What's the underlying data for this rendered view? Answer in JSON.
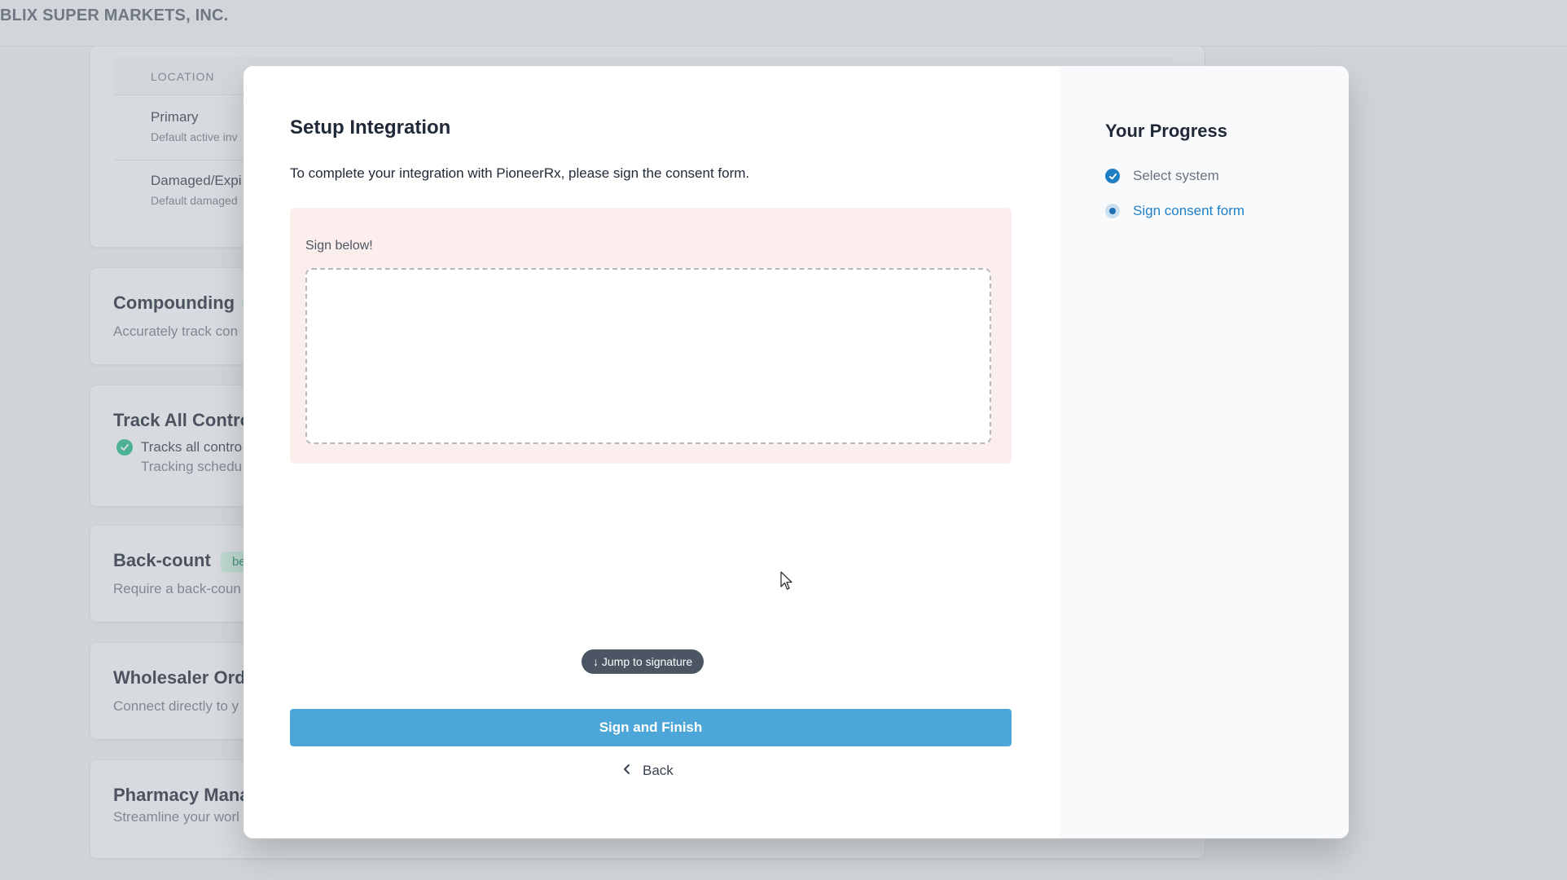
{
  "header": {
    "company": "BLIX SUPER MARKETS, INC."
  },
  "locations": {
    "column_header": "LOCATION",
    "rows": [
      {
        "name": "Primary",
        "desc": "Default active inv"
      },
      {
        "name": "Damaged/Expi",
        "desc": "Default damaged"
      }
    ]
  },
  "sections": {
    "compounding": {
      "title": "Compounding",
      "desc": "Accurately track con"
    },
    "controlled": {
      "title": "Track All Contro",
      "check_text": "Tracks all contro",
      "check_sub": "Tracking schedu"
    },
    "backcount": {
      "title": "Back-count",
      "badge": "be",
      "desc": "Require a back-coun"
    },
    "wholesaler": {
      "title": "Wholesaler Ord",
      "desc": "Connect directly to y"
    },
    "pharmacy": {
      "title": "Pharmacy Mana",
      "desc": "Streamline your worl"
    }
  },
  "modal": {
    "title": "Setup Integration",
    "subtitle": "To complete your integration with PioneerRx, please sign the consent form.",
    "sign_label": "Sign below!",
    "jump_label": "↓ Jump to signature",
    "finish_label": "Sign and Finish",
    "back_label": "Back"
  },
  "progress": {
    "title": "Your Progress",
    "steps": [
      {
        "label": "Select system",
        "state": "done"
      },
      {
        "label": "Sign consent form",
        "state": "active"
      }
    ]
  },
  "colors": {
    "primary_button": "#4ca7d8",
    "step_done": "#1f7fc4",
    "step_active_text": "#1f7fc4",
    "sign_area_bg": "#fdeeee"
  }
}
